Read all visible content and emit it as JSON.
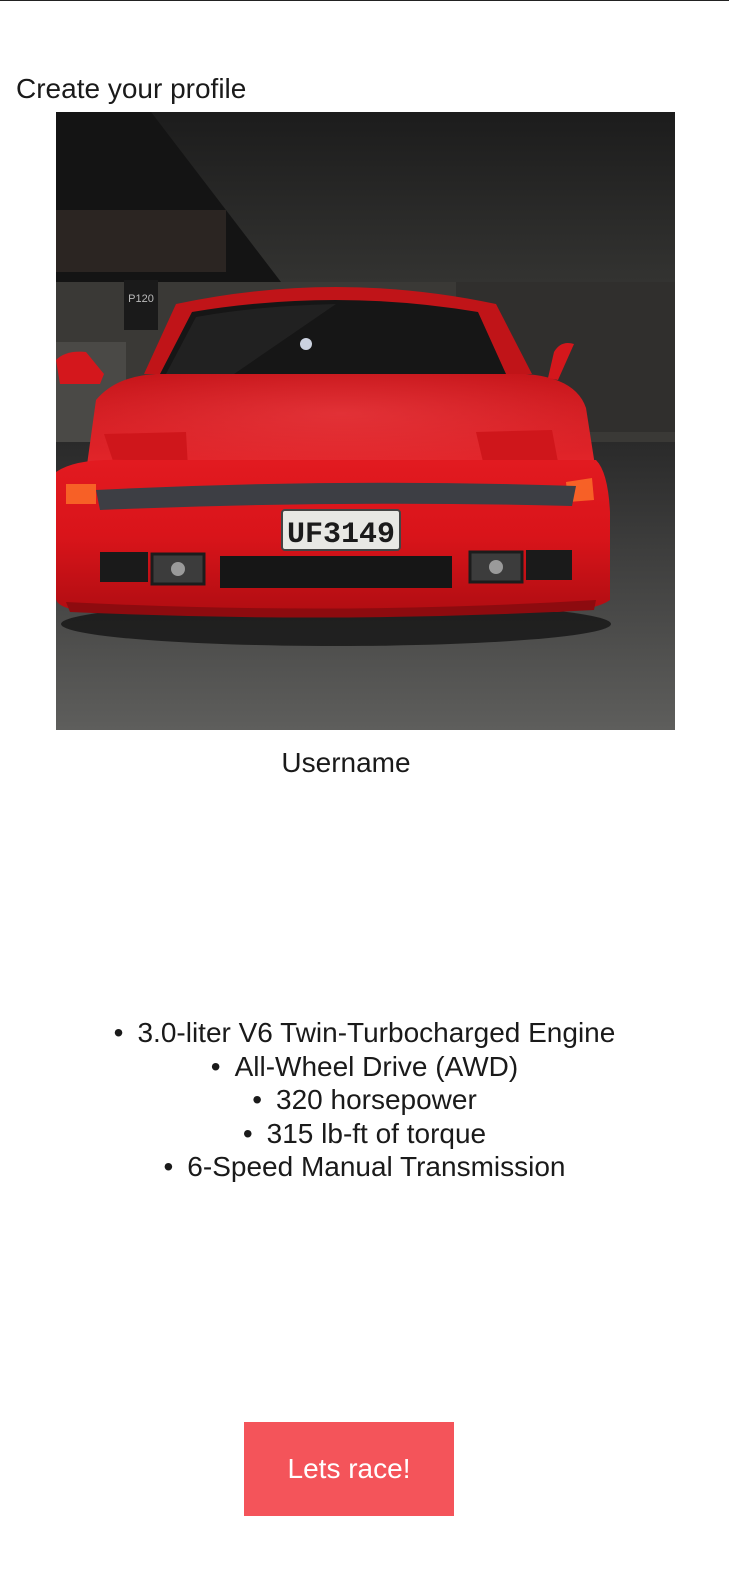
{
  "page": {
    "title": "Create your profile"
  },
  "profile": {
    "photo_icon": "car-photo",
    "plate_text": "UF3149",
    "sign_text": "P120",
    "username_label": "Username"
  },
  "specs": [
    "3.0-liter V6 Twin-Turbocharged Engine",
    "All-Wheel Drive (AWD)",
    "320 horsepower",
    "315 lb-ft of torque",
    "6-Speed Manual Transmission"
  ],
  "cta": {
    "label": "Lets race!",
    "color": "#f4545a"
  }
}
